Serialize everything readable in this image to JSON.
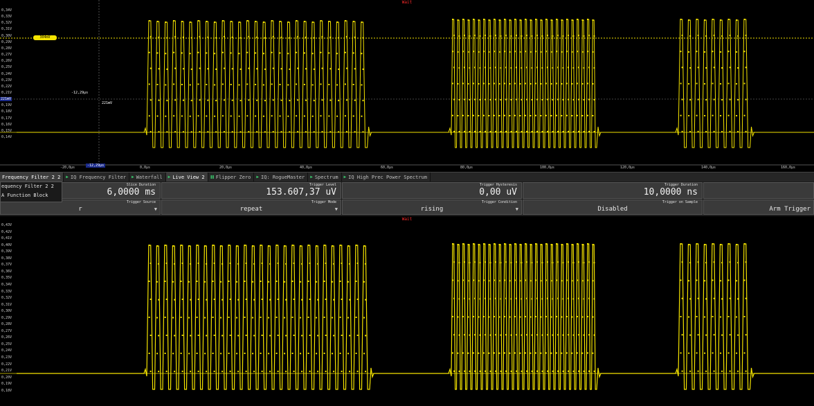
{
  "top_plot": {
    "status": "Wait",
    "y_ticks": [
      "0,34V",
      "0,33V",
      "0,32V",
      "0,31V",
      "0,30V",
      "0,29V",
      "0,28V",
      "0,27V",
      "0,26V",
      "0,25V",
      "0,24V",
      "0,23V",
      "0,22V",
      "0,21V",
      "0,20V",
      "0,19V",
      "0,18V",
      "0,17V",
      "0,16V",
      "0,15V",
      "0,14V"
    ],
    "x_ticks": [
      "-20,0µs",
      "0,0µs",
      "20,0µs",
      "40,0µs",
      "60,0µs",
      "80,0µs",
      "100,0µs",
      "120,0µs",
      "140,0µs",
      "160,0µs"
    ],
    "cursor_x_label": "-12,29µs",
    "cursor_x_axis_label": "-12,29µs",
    "cursor_y_label": "221mV",
    "cursor_y_axis_label": "221mV",
    "trigger_marker_label": "304mV"
  },
  "tabs": [
    {
      "label": "Frequency Filter 2 2",
      "icon": "none",
      "active": true
    },
    {
      "label": "IQ Frequency Filter",
      "icon": "play-icon",
      "active": false
    },
    {
      "label": "Waterfall",
      "icon": "play-icon",
      "active": false
    },
    {
      "label": "Live View 2",
      "icon": "play-icon",
      "active": true
    },
    {
      "label": "Flipper Zero",
      "icon": "pause-icon",
      "active": false
    },
    {
      "label": "IQ: RogueMaster",
      "icon": "play-icon",
      "active": false
    },
    {
      "label": "Spectrum",
      "icon": "play-icon",
      "active": false
    },
    {
      "label": "IQ High Prec Power Spectrum",
      "icon": "play-icon",
      "active": false
    }
  ],
  "menu": {
    "items": [
      "equency Filter 2 2",
      "A Function Block"
    ]
  },
  "controls": {
    "slice_duration": {
      "label": "Slice Duration",
      "value": "6,0000 ms"
    },
    "trigger_level": {
      "label": "Trigger Level",
      "value": "153.607,37 uV"
    },
    "trigger_hysteresis": {
      "label": "Trigger Hysteresis",
      "value": "0,00 uV"
    },
    "trigger_duration": {
      "label": "Trigger Duration",
      "value": "10,0000 ns"
    },
    "trigger_source": {
      "label": "Trigger Source",
      "value": "r"
    },
    "trigger_mode": {
      "label": "Trigger Mode",
      "value": "repeat"
    },
    "trigger_condition": {
      "label": "Trigger Condition",
      "value": "rising"
    },
    "trigger_on_sample": {
      "label": "Trigger on Sample",
      "value": "Disabled"
    },
    "arm_trigger": {
      "label": "Arm Trigger"
    }
  },
  "bottom_plot": {
    "status": "Wait",
    "y_ticks": [
      "0,43V",
      "0,42V",
      "0,41V",
      "0,40V",
      "0,39V",
      "0,38V",
      "0,37V",
      "0,36V",
      "0,35V",
      "0,34V",
      "0,33V",
      "0,32V",
      "0,31V",
      "0,30V",
      "0,29V",
      "0,28V",
      "0,27V",
      "0,26V",
      "0,25V",
      "0,24V",
      "0,23V",
      "0,22V",
      "0,21V",
      "0,20V",
      "0,19V",
      "0,18V"
    ]
  },
  "colors": {
    "trace": "#f5e400",
    "background": "#000000",
    "status": "#ff2a2a",
    "play_icon": "#39c46a"
  }
}
